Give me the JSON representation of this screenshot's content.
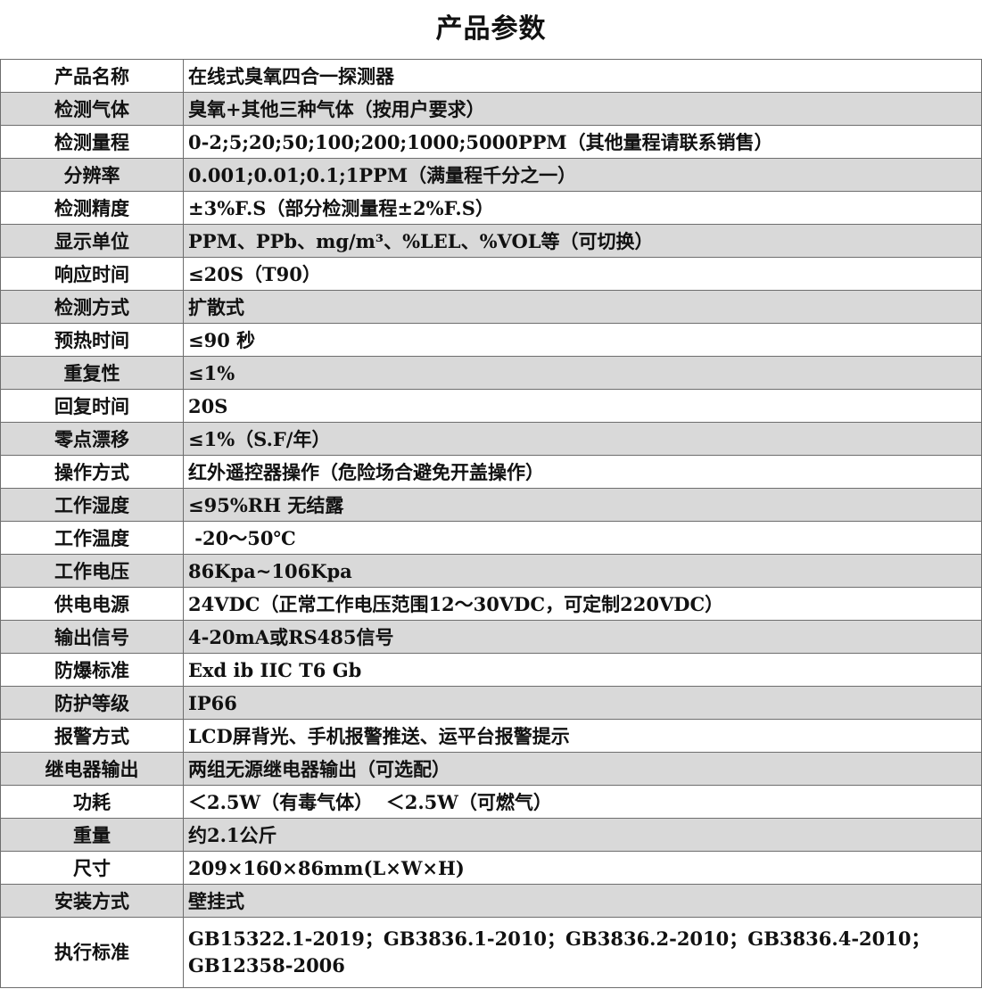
{
  "title": "产品参数",
  "rows": [
    {
      "label": "产品名称",
      "value": "在线式臭氧四合一探测器"
    },
    {
      "label": "检测气体",
      "value": "臭氧+其他三种气体（按用户要求）"
    },
    {
      "label": "检测量程",
      "value": "0-2;5;20;50;100;200;1000;5000PPM（其他量程请联系销售）"
    },
    {
      "label": "分辨率",
      "value": "0.001;0.01;0.1;1PPM（满量程千分之一）"
    },
    {
      "label": "检测精度",
      "value": "±3%F.S（部分检测量程±2%F.S）"
    },
    {
      "label": "显示单位",
      "value": "PPM、PPb、mg/m³、%LEL、%VOL等（可切换）"
    },
    {
      "label": "响应时间",
      "value": "≤20S（T90）"
    },
    {
      "label": "检测方式",
      "value": "扩散式"
    },
    {
      "label": "预热时间",
      "value": "≤90 秒"
    },
    {
      "label": "重复性",
      "value": "≤1%"
    },
    {
      "label": "回复时间",
      "value": "20S"
    },
    {
      "label": "零点漂移",
      "value": "≤1%（S.F/年）"
    },
    {
      "label": "操作方式",
      "value": "红外遥控器操作（危险场合避免开盖操作）"
    },
    {
      "label": "工作湿度",
      "value": "≤95%RH 无结露"
    },
    {
      "label": "工作温度",
      "value": " -20～50℃"
    },
    {
      "label": "工作电压",
      "value": "86Kpa~106Kpa"
    },
    {
      "label": "供电电源",
      "value": "24VDC（正常工作电压范围12～30VDC，可定制220VDC）"
    },
    {
      "label": "输出信号",
      "value": "4-20mA或RS485信号"
    },
    {
      "label": "防爆标准",
      "value": "Exd ib IIC T6 Gb"
    },
    {
      "label": "防护等级",
      "value": "IP66"
    },
    {
      "label": "报警方式",
      "value": "LCD屏背光、手机报警推送、运平台报警提示"
    },
    {
      "label": "继电器输出",
      "value": "两组无源继电器输出（可选配）"
    },
    {
      "label": "功耗",
      "value": "＜2.5W（有毒气体）  ＜2.5W（可燃气）"
    },
    {
      "label": "重量",
      "value": "约2.1公斤"
    },
    {
      "label": "尺寸",
      "value": "209×160×86mm(L×W×H)"
    },
    {
      "label": "安装方式",
      "value": "壁挂式"
    },
    {
      "label": "执行标准",
      "value": "GB15322.1-2019；GB3836.1-2010；GB3836.2-2010；GB3836.4-2010；GB12358-2006"
    }
  ]
}
